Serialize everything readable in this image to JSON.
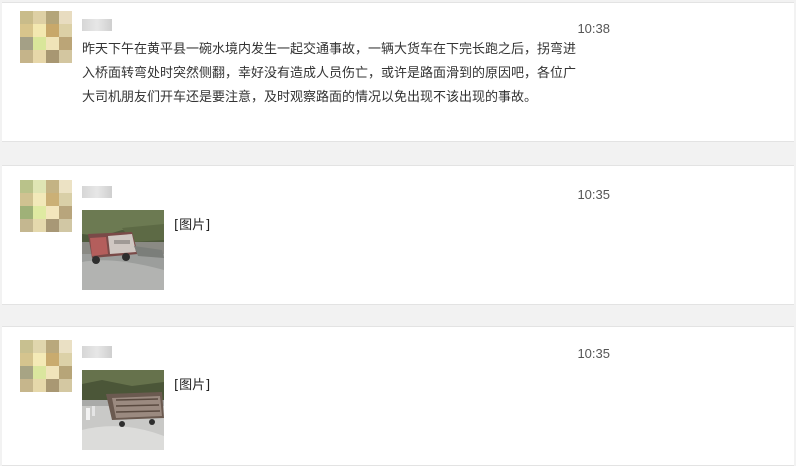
{
  "messages": [
    {
      "time": "10:38",
      "text": "昨天下午在黄平县一碗水境内发生一起交通事故，一辆大货车在下完长跑之后，拐弯进入桥面转弯处时突然侧翻，幸好没有造成人员伤亡，或许是路面滑到的原因吧，各位广大司机朋友们开车还是要注意，及时观察路面的情况以免出现不该出现的事故。"
    },
    {
      "time": "10:35",
      "image_label": "[图片]"
    },
    {
      "time": "10:35",
      "image_label": "[图片]"
    }
  ]
}
